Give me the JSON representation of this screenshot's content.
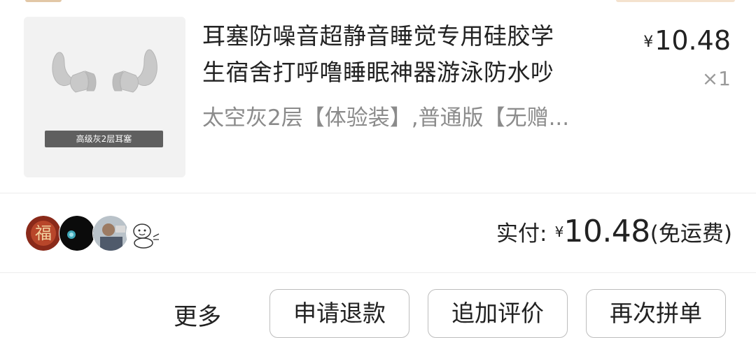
{
  "product": {
    "title_line1": "耳塞防噪音超静音睡觉专用硅胶学",
    "title_line2": "生宿舍打呼噜睡眠神器游泳防水吵",
    "variant": "太空灰2层【体验装】,普通版【无赠...",
    "thumbnail_caption": "高级灰2层耳塞",
    "price_currency": "¥",
    "price": "10.48",
    "quantity": "×1"
  },
  "payment": {
    "label": "实付:",
    "currency": "¥",
    "amount": "10.48",
    "note": "(免运费)"
  },
  "group_avatars": [
    "avatar-fu",
    "avatar-dark",
    "avatar-photo",
    "avatar-cartoon"
  ],
  "actions": {
    "more": "更多",
    "refund": "申请退款",
    "add_review": "追加评价",
    "regroup": "再次拼单"
  },
  "colors": {
    "title_text": "#222222",
    "variant_text": "#8b8b8b",
    "quantity_text": "#9a9a9a",
    "thumb_bg": "#f2f2f2",
    "button_border": "#bdbdbd"
  }
}
